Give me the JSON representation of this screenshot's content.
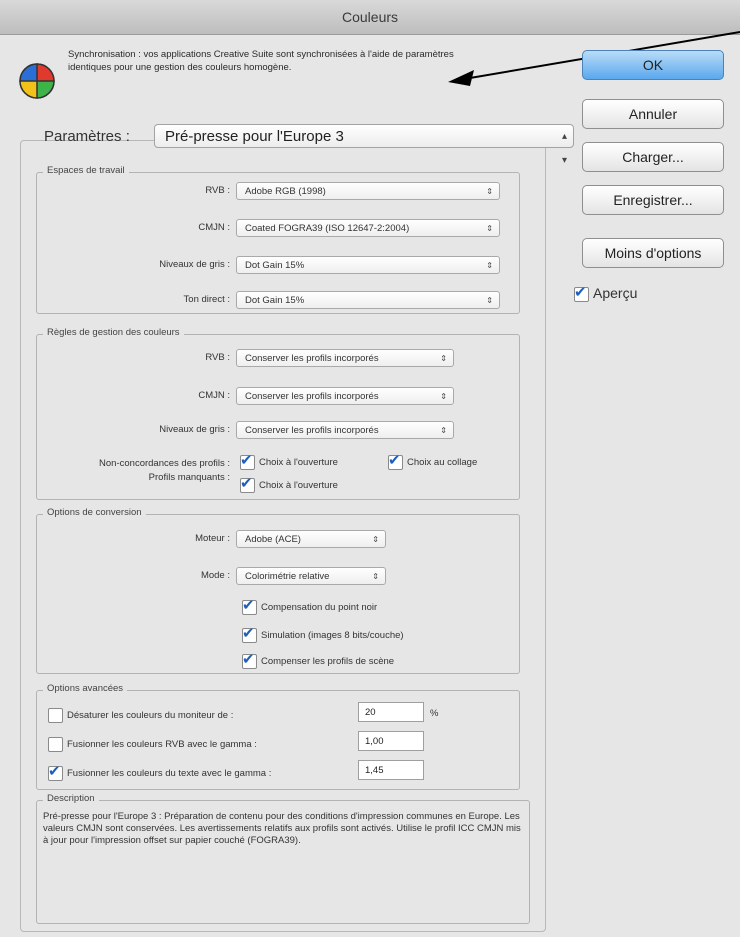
{
  "window": {
    "title": "Couleurs"
  },
  "sync": {
    "text": "Synchronisation : vos applications Creative Suite sont synchronisées à l'aide de paramètres identiques pour une gestion des couleurs homogène."
  },
  "buttons": {
    "ok": "OK",
    "cancel": "Annuler",
    "load": "Charger...",
    "save": "Enregistrer...",
    "fewer_options": "Moins d'options",
    "preview": "Aperçu",
    "preview_checked": true
  },
  "settings": {
    "label": "Paramètres :",
    "value": "Pré-presse pour l'Europe 3"
  },
  "working_spaces": {
    "title": "Espaces de travail",
    "rows": [
      {
        "label": "RVB :",
        "value": "Adobe RGB (1998)"
      },
      {
        "label": "CMJN :",
        "value": "Coated FOGRA39 (ISO 12647-2:2004)"
      },
      {
        "label": "Niveaux de gris :",
        "value": "Dot Gain 15%"
      },
      {
        "label": "Ton direct :",
        "value": "Dot Gain 15%"
      }
    ]
  },
  "policies": {
    "title": "Règles de gestion des couleurs",
    "rows": [
      {
        "label": "RVB :",
        "value": "Conserver les profils incorporés"
      },
      {
        "label": "CMJN :",
        "value": "Conserver les profils incorporés"
      },
      {
        "label": "Niveaux de gris :",
        "value": "Conserver les profils incorporés"
      }
    ],
    "mismatch_label": "Non-concordances des profils :",
    "missing_label": "Profils manquants :",
    "ask_open": "Choix à l'ouverture",
    "ask_paste": "Choix au collage",
    "ask_open_missing": "Choix à l'ouverture"
  },
  "conversion": {
    "title": "Options de conversion",
    "engine_label": "Moteur :",
    "engine_value": "Adobe (ACE)",
    "intent_label": "Mode :",
    "intent_value": "Colorimétrie relative",
    "options": [
      "Compensation du point noir",
      "Simulation (images 8 bits/couche)",
      "Compenser les profils de scène"
    ]
  },
  "advanced": {
    "title": "Options avancées",
    "rows": [
      {
        "label": "Désaturer les couleurs du moniteur de :",
        "value": "20",
        "unit": "%",
        "checked": false
      },
      {
        "label": "Fusionner les couleurs RVB avec le gamma :",
        "value": "1,00",
        "checked": false
      },
      {
        "label": "Fusionner les couleurs du texte avec le gamma :",
        "value": "1,45",
        "checked": true
      }
    ]
  },
  "description": {
    "title": "Description",
    "text": "Pré-presse pour l'Europe 3 : Préparation de contenu pour des conditions d'impression communes en Europe. Les valeurs CMJN sont conservées. Les avertissements relatifs aux profils sont activés. Utilise le profil ICC CMJN mis à jour pour l'impression offset sur papier couché (FOGRA39)."
  }
}
